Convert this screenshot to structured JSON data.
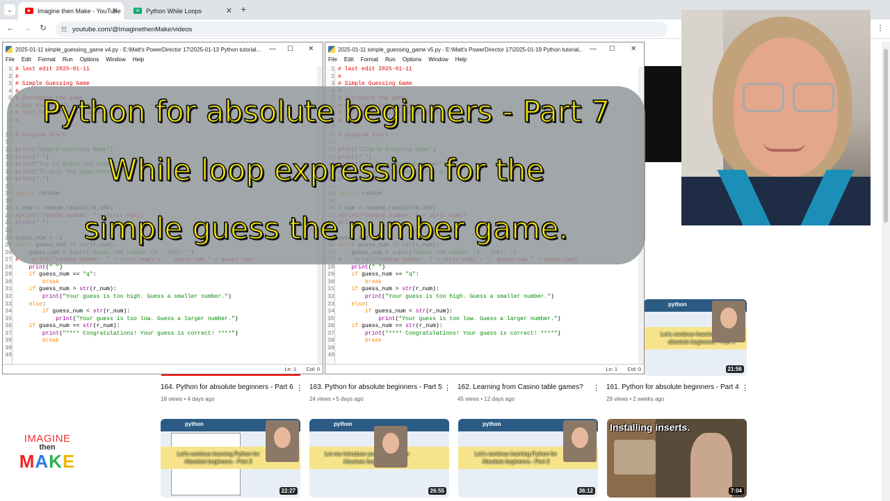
{
  "browser": {
    "tabs": [
      {
        "title": "Imagine then Make - YouTube",
        "favicon": "youtube-icon",
        "active": true
      },
      {
        "title": "Python While Loops",
        "favicon": "w3schools-icon",
        "active": false
      }
    ],
    "url": "youtube.com/@ImaginethenMake/videos"
  },
  "idle_left": {
    "title": "2025-01-11 simple_guessing_game v4.py - E:\\Matt's PowerDirector 17\\2025-01-13 Python tutorial...",
    "menu": [
      "File",
      "Edit",
      "Format",
      "Run",
      "Options",
      "Window",
      "Help"
    ],
    "line_numbers": [
      "1",
      "2",
      "3",
      "4",
      "5",
      "6",
      "7",
      "8",
      "9",
      "10",
      "11",
      "12",
      "13",
      "14",
      "15",
      "16",
      "17",
      "18",
      "19",
      "20",
      "21",
      "22",
      "23",
      "24",
      "25",
      "26",
      "27",
      "28",
      "29",
      "30",
      "31",
      "32",
      "33",
      "34",
      "35",
      "36",
      "37",
      "38",
      "39",
      "40"
    ],
    "status_ln": "Ln: 1",
    "status_col": "Col: 0"
  },
  "idle_right": {
    "title": "2025-01-11 simple_guessing_game v5.py - E:\\Matt's PowerDirector 17\\2025-01-19 Python tutorial...",
    "menu": [
      "File",
      "Edit",
      "Format",
      "Run",
      "Options",
      "Window",
      "Help"
    ],
    "status_ln": "Ln: 1",
    "status_col": "Col: 0"
  },
  "code_lines": [
    "# last edit 2025-01-11",
    "#",
    "# Simple Guessing Game",
    "#",
    "# Introduce the game",
    "# Get the user's guess",
    "# Tell them if they guessed it",
    "#",
    "",
    "# program start",
    "",
    "print(\"Simple Guessing Game\")",
    "print(\" \")",
    "print(\"Try to guess the number\")",
    "print(\"To quit the game enter q\")",
    "print(\" \")",
    "",
    "import random",
    "",
    "r_num = random.randint(0,100)",
    "#print(\"random number: \" + str(r_num))",
    "print(\" \")",
    "",
    "guess_num = -1",
    "while guess_num != str(r_num):",
    "    guess_num = input(\"Guess the number (0 - 100): \")",
    "#    print(\"random number: \" + str(r_num) + \"  guess_num \" + guess_num)",
    "    print(\" \")",
    "    if guess_num == \"q\":",
    "        break",
    "    if guess_num > str(r_num):",
    "        print(\"Your guess is too high. Guess a smaller number.\")",
    "    else:",
    "        if guess_num < str(r_num):",
    "            print(\"Your guess is too low. Guess a larger number.\")",
    "    if guess_num == str(r_num):",
    "        print(\"**** Congratulations! Your guess is correct! ****\")",
    "        break",
    "",
    ""
  ],
  "overlay": {
    "line1": "Python for absolute beginners - Part 7",
    "line2": "While loop expression for the",
    "line3": "simple guess the number game."
  },
  "videos_row1": [
    {
      "title": "164. Python for absolute beginners - Part 6",
      "meta": "18 views • 4 days ago"
    },
    {
      "title": "163. Python for absolute beginners - Part 5",
      "meta": "24 views • 5 days ago"
    },
    {
      "title": "162. Learning from Casino table games?",
      "meta": "45 views • 12 days ago"
    },
    {
      "title": "161. Python for absolute beginners - Part 4",
      "meta": "29 views • 2 weeks ago",
      "duration": "21:56",
      "thumb_text": "Let's continue learning Python for absolute beginners - Part 4"
    }
  ],
  "videos_row2": [
    {
      "duration": "22:27",
      "thumb_text": "Let's continue learning Python for Absolute beginners - Part 3"
    },
    {
      "duration": "26:55",
      "thumb_text": "Let me introduce you to Python for Absolute beginners"
    },
    {
      "duration": "36:12",
      "thumb_text": "Let's continue learning Python for Absolute beginners - Part 2"
    },
    {
      "duration": "7:04",
      "thumb_text": "Installing inserts."
    }
  ],
  "logo": {
    "line1": "IMAGINE",
    "line2": "then",
    "line3": [
      "M",
      "A",
      "K",
      "E"
    ]
  },
  "colors": {
    "overlay_text": "#f2e60a",
    "yt_red": "#ff0000",
    "comment": "#dd0000",
    "keyword": "#ff8800",
    "string": "#008800"
  }
}
